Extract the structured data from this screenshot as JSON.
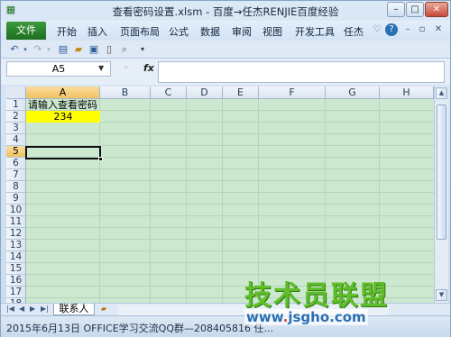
{
  "window": {
    "title": "查看密码设置.xlsm - 百度→任杰RENJIE百度经验"
  },
  "ribbon": {
    "file_tab": "文件",
    "tabs": [
      "开始",
      "插入",
      "页面布局",
      "公式",
      "数据",
      "审阅",
      "视图",
      "开发工具",
      "任杰"
    ]
  },
  "formula_bar": {
    "name_box": "A5",
    "fx_label": "fx",
    "content": ""
  },
  "sheet": {
    "columns": [
      "A",
      "B",
      "C",
      "D",
      "E",
      "F",
      "G",
      "H"
    ],
    "selected_column": "A",
    "rows": [
      "1",
      "2",
      "3",
      "4",
      "5",
      "6",
      "7",
      "8",
      "9",
      "10",
      "11",
      "12",
      "13",
      "14",
      "15",
      "16",
      "17",
      "18"
    ],
    "selected_row": "5",
    "selected_cell": "A5",
    "cells": {
      "A1": "请输入查看密码",
      "A2": "234"
    },
    "highlight_color": "#ffff00"
  },
  "tabs": {
    "sheets": [
      "联系人"
    ]
  },
  "status_bar": {
    "text": "2015年6月13日   OFFICE学习交流QQ群—208405816  任..."
  },
  "watermark": {
    "line1": "技术员联盟",
    "line2_prefix": "www",
    "line2_dot": ".",
    "line2_mid": "jsgho",
    "line2_suffix": ".com"
  }
}
